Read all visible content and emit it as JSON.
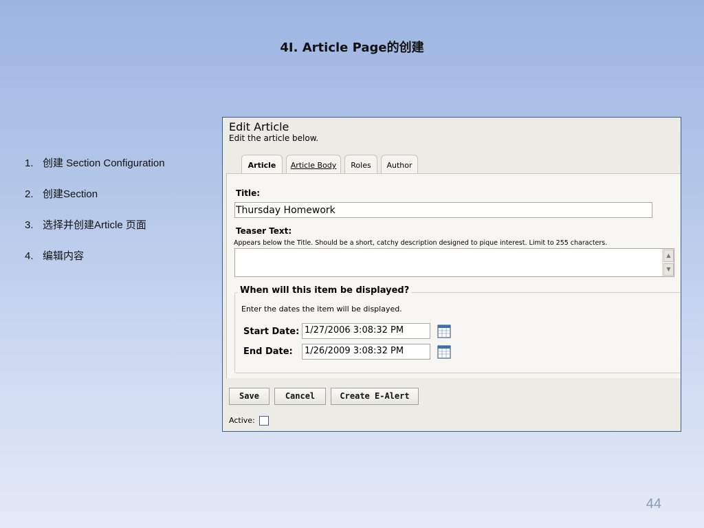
{
  "slide": {
    "title": "4I. Article Page的创建",
    "steps": [
      {
        "num": "1.",
        "text": "创建 Section Configuration"
      },
      {
        "num": "2.",
        "text": "创建Section"
      },
      {
        "num": "3.",
        "text": "选择并创建Article 页面"
      },
      {
        "num": "4.",
        "text": "编辑内容"
      }
    ],
    "page_number": "44"
  },
  "editor": {
    "heading": "Edit Article",
    "subheading": "Edit the article below.",
    "tabs": [
      {
        "label": "Article",
        "state": "active"
      },
      {
        "label": "Article Body",
        "state": "link"
      },
      {
        "label": "Roles",
        "state": "normal"
      },
      {
        "label": "Author",
        "state": "normal"
      }
    ],
    "title_field": {
      "label": "Title:",
      "value": "Thursday Homework"
    },
    "teaser_field": {
      "label": "Teaser Text:",
      "hint": "Appears below the Title. Should be a short, catchy description designed to pique interest. Limit to 255 characters.",
      "value": ""
    },
    "display_section": {
      "legend": "When will this item be displayed?",
      "hint": "Enter the dates the item will be displayed.",
      "start_label": "Start Date:",
      "start_value": "1/27/2006 3:08:32 PM",
      "end_label": "End Date:",
      "end_value": "1/26/2009 3:08:32 PM"
    },
    "buttons": {
      "save": "Save",
      "cancel": "Cancel",
      "alert": "Create E-Alert"
    },
    "active": {
      "label": "Active:",
      "checked": false
    },
    "icons": {
      "calendar": "calendar-icon",
      "scroll_up": "arrow-up-icon",
      "scroll_down": "arrow-down-icon"
    }
  }
}
